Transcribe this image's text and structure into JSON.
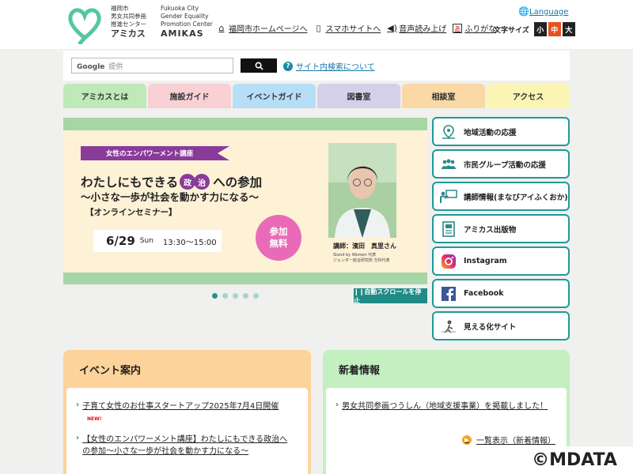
{
  "header": {
    "logo_jp": [
      "福岡市",
      "男女共同参画",
      "推進センター"
    ],
    "logo_jp_name": "アミカス",
    "logo_en": [
      "Fukuoka City",
      "Gender Equality",
      "Promotion Center"
    ],
    "logo_en_name": "AMIKAS",
    "language": "Language",
    "links": [
      {
        "label": "福岡市ホームページへ",
        "icon": "home-icon"
      },
      {
        "label": "スマホサイトへ",
        "icon": "smartphone-icon"
      },
      {
        "label": "音声読み上げ",
        "icon": "speaker-icon"
      },
      {
        "label": "ふりがな",
        "icon": "furigana-icon"
      }
    ],
    "furigana_icon_char": "あ",
    "text_size_label": "文字サイズ",
    "text_sizes": [
      {
        "label": "小",
        "color": "#222222"
      },
      {
        "label": "中",
        "color": "#e8501e"
      },
      {
        "label": "大",
        "color": "#222222"
      }
    ]
  },
  "search": {
    "placeholder_brand": "Google",
    "placeholder": "提供",
    "button_icon": "search-icon",
    "help_link": "サイト内検索について"
  },
  "nav": [
    {
      "label": "アミカスとは",
      "color": "#bfe9b8"
    },
    {
      "label": "施設ガイド",
      "color": "#f9d0d4"
    },
    {
      "label": "イベントガイド",
      "color": "#b7def7"
    },
    {
      "label": "図書室",
      "color": "#d5d0ea"
    },
    {
      "label": "相談室",
      "color": "#fbd9a6"
    },
    {
      "label": "アクセス",
      "color": "#fbf5b4"
    }
  ],
  "slide": {
    "ribbon": "女性のエンパワーメント講座",
    "title_a": "わたしにもできる",
    "title_c1": "政",
    "title_c2": "治",
    "title_b": "への参加",
    "subtitle": "～小さな一歩が社会を動かす力になる～",
    "type": "【オンラインセミナー】",
    "date": "6/29",
    "weekday": "Sun",
    "time": "13:30～15:00",
    "free_1": "参加",
    "free_2": "無料",
    "speaker": "講師：濱田　真里さん",
    "speaker_aff_1": "Stand by Women 代表",
    "speaker_aff_2": "ジェンダー総合研究所 万科代表",
    "dot_count": 5,
    "active_dot": 0,
    "stop_button": "❙❙自動スクロールを停止"
  },
  "side_menu": [
    {
      "label": "地域活動の応援",
      "icon": "map-pin-icon"
    },
    {
      "label": "市民グループ活動の応援",
      "icon": "group-icon"
    },
    {
      "label": "講師情報(まなびアイふくおか)",
      "icon": "lecturer-icon"
    },
    {
      "label": "アミカス出版物",
      "icon": "publication-icon"
    },
    {
      "label": "Instagram",
      "icon": "instagram-icon"
    },
    {
      "label": "Facebook",
      "icon": "facebook-icon"
    },
    {
      "label": "見える化サイト",
      "icon": "visualization-icon"
    }
  ],
  "events": {
    "title": "イベント案内",
    "items": [
      {
        "text": "子育て女性のお仕事スタートアップ2025年7月4日開催",
        "badge": "NEW!"
      },
      {
        "text": "【女性のエンパワーメント講座】わたしにもできる政治への参加～小さな一歩が社会を動かす力になる～"
      }
    ]
  },
  "news": {
    "title": "新着情報",
    "items": [
      {
        "text": "男女共同参画つうしん（地域支援事業）を掲載しました！"
      }
    ],
    "more": "一覧表示（新着情報）"
  },
  "watermark": "©MDATA"
}
